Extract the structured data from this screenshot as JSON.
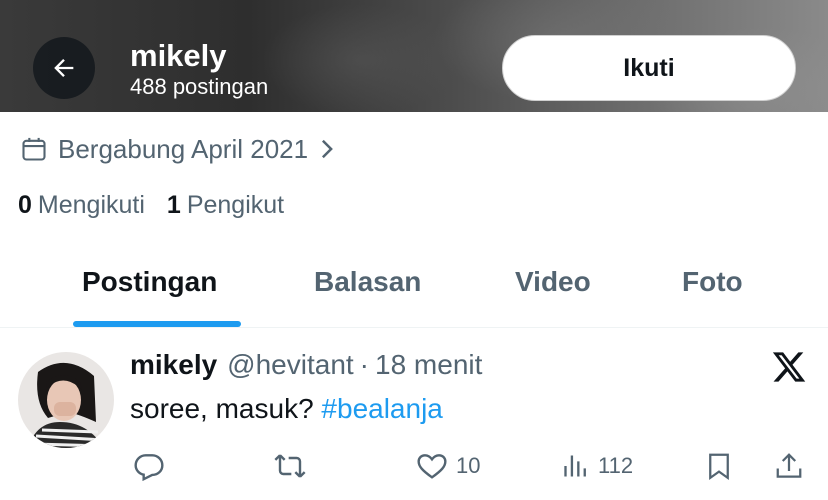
{
  "header": {
    "name": "mikely",
    "post_count": "488 postingan",
    "follow_label": "Ikuti"
  },
  "profile": {
    "joined": "Bergabung April 2021",
    "following_count": "0",
    "following_label": "Mengikuti",
    "followers_count": "1",
    "followers_label": "Pengikut"
  },
  "tabs": [
    {
      "label": "Postingan",
      "active": true
    },
    {
      "label": "Balasan",
      "active": false
    },
    {
      "label": "Video",
      "active": false
    },
    {
      "label": "Foto",
      "active": false
    }
  ],
  "post": {
    "name": "mikely",
    "handle": "@hevitant",
    "separator": "·",
    "time": "18 menit",
    "text": "soree, masuk? ",
    "hashtag": "#bealanja",
    "likes": "10",
    "views": "112"
  },
  "colors": {
    "accent": "#1d9bf0",
    "text_primary": "#0f1419",
    "text_secondary": "#536471"
  },
  "icons": [
    "back-arrow-icon",
    "calendar-icon",
    "chevron-right-icon",
    "x-logo-icon",
    "reply-icon",
    "repost-icon",
    "like-icon",
    "views-icon",
    "bookmark-icon",
    "share-icon"
  ]
}
